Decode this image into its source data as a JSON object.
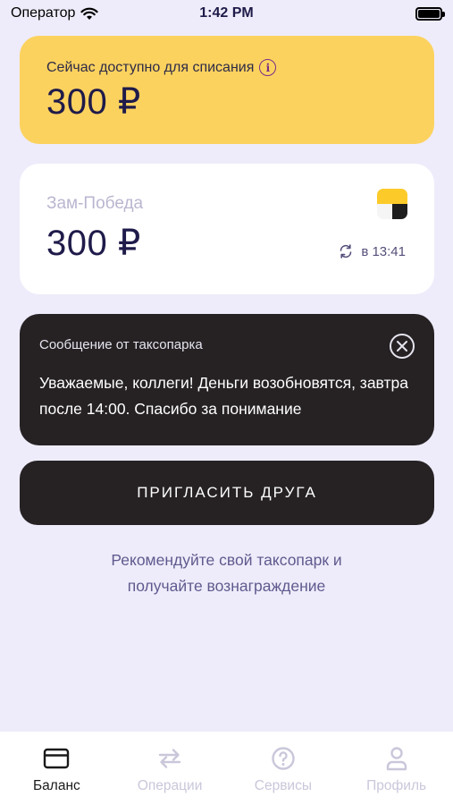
{
  "status_bar": {
    "carrier": "Оператор",
    "time": "1:42 PM"
  },
  "available_card": {
    "label": "Сейчас доступно для списания",
    "amount": "300 ₽",
    "info_icon": "info-icon",
    "color": "#FCD25F"
  },
  "park_card": {
    "name": "Зам-Победа",
    "amount": "300 ₽",
    "sync_time": "в 13:41",
    "logo": "yandex-pro-logo"
  },
  "message_card": {
    "title": "Сообщение от таксопарка",
    "body": "Уважаемые, коллеги! Деньги возобновятся, завтра после 14:00. Спасибо за понимание",
    "close_icon": "close-icon"
  },
  "invite": {
    "button_label": "ПРИГЛАСИТЬ ДРУГА",
    "recommend_line1": "Рекомендуйте свой таксопарк и",
    "recommend_line2": "получайте вознаграждение"
  },
  "tabs": [
    {
      "label": "Баланс",
      "icon": "card-icon",
      "active": true
    },
    {
      "label": "Операции",
      "icon": "transfer-icon",
      "active": false
    },
    {
      "label": "Сервисы",
      "icon": "help-icon",
      "active": false
    },
    {
      "label": "Профиль",
      "icon": "user-icon",
      "active": false
    }
  ]
}
